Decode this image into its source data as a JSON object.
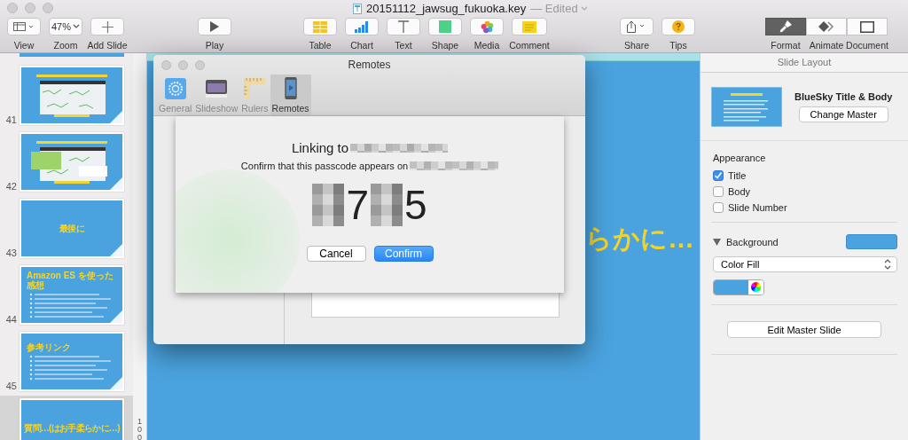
{
  "window": {
    "title": "20151112_jawsug_fukuoka.key",
    "status": "— Edited"
  },
  "toolbar": {
    "left": [
      {
        "kind": "view",
        "label": "View"
      },
      {
        "kind": "zoom",
        "label": "Zoom",
        "value": "47%"
      },
      {
        "kind": "add",
        "label": "Add Slide"
      }
    ],
    "center": [
      {
        "kind": "play",
        "label": "Play"
      }
    ],
    "insert": [
      {
        "kind": "table",
        "label": "Table"
      },
      {
        "kind": "chart",
        "label": "Chart"
      },
      {
        "kind": "text",
        "label": "Text"
      },
      {
        "kind": "shape",
        "label": "Shape"
      },
      {
        "kind": "media",
        "label": "Media"
      },
      {
        "kind": "comment",
        "label": "Comment"
      }
    ],
    "right": [
      {
        "kind": "share",
        "label": "Share"
      },
      {
        "kind": "tips",
        "label": "Tips"
      }
    ],
    "inspector_tabs": [
      {
        "kind": "format",
        "label": "Format",
        "selected": true
      },
      {
        "kind": "animate",
        "label": "Animate",
        "selected": false
      },
      {
        "kind": "document",
        "label": "Document",
        "selected": false
      }
    ]
  },
  "slides": [
    {
      "number": "41",
      "kind": "screenshot",
      "selected": false
    },
    {
      "number": "42",
      "kind": "screenshot",
      "selected": false
    },
    {
      "number": "43",
      "kind": "title",
      "title": "最後に",
      "selected": false
    },
    {
      "number": "44",
      "kind": "bullets",
      "title": "Amazon ES を使った感想",
      "selected": false
    },
    {
      "number": "45",
      "kind": "bullets",
      "title": "参考リンク",
      "selected": false
    },
    {
      "kind": "title",
      "title": "質問…(はお手柔らかに…)",
      "selected": true
    }
  ],
  "ruler_label": "100",
  "canvas": {
    "text": "らかに…"
  },
  "dialog": {
    "title": "Remotes",
    "tabs": [
      {
        "kind": "general",
        "label": "General",
        "selected": false
      },
      {
        "kind": "slideshow",
        "label": "Slideshow",
        "selected": false
      },
      {
        "kind": "rulers",
        "label": "Rulers",
        "selected": false
      },
      {
        "kind": "remotes",
        "label": "Remotes",
        "selected": true
      }
    ],
    "sheet": {
      "heading": "Linking to",
      "message": "Confirm that this passcode appears on",
      "passcode": [
        {
          "kind": "hidden"
        },
        {
          "kind": "digit",
          "text": "7"
        },
        {
          "kind": "hidden"
        },
        {
          "kind": "digit",
          "text": "5"
        }
      ],
      "buttons": [
        {
          "label": "Cancel",
          "default": false
        },
        {
          "label": "Confirm",
          "default": true
        }
      ]
    }
  },
  "inspector": {
    "header": "Slide Layout",
    "master_name": "BlueSky Title & Body",
    "change_master": "Change Master",
    "appearance_label": "Appearance",
    "appearance": [
      {
        "label": "Title",
        "checked": true
      },
      {
        "label": "Body",
        "checked": false
      },
      {
        "label": "Slide Number",
        "checked": false
      }
    ],
    "background": {
      "label": "Background",
      "expanded": true,
      "color": "#4aa3df",
      "fill": "Color Fill"
    },
    "edit_master": "Edit Master Slide"
  }
}
